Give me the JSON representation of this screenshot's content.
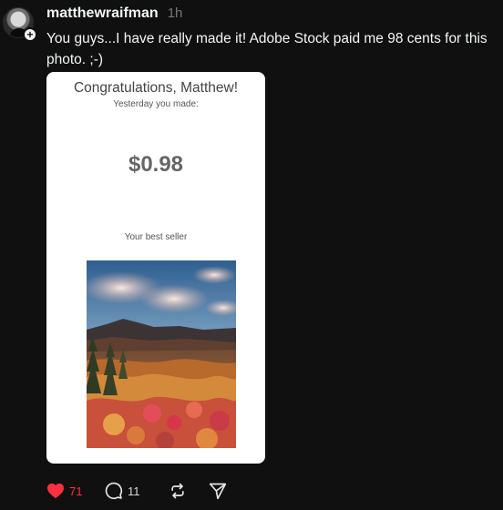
{
  "post": {
    "username": "matthewraifman",
    "time": "1h",
    "text": "You guys...I have really made it! Adobe Stock paid me 98 cents for this photo. ;-)",
    "avatar_icon": "user-avatar",
    "follow_icon": "plus-icon",
    "follow_label": "+"
  },
  "card": {
    "title": "Congratulations, Matthew!",
    "subtitle": "Yesterday you made:",
    "amount": "$0.98",
    "best_seller": "Your best seller",
    "photo_icon": "mountain-landscape-photo"
  },
  "actions": {
    "likes": "71",
    "replies": "11",
    "like_icon": "heart-icon",
    "reply_icon": "comment-icon",
    "repost_icon": "repost-icon",
    "share_icon": "send-icon"
  },
  "colors": {
    "background": "#101010",
    "text": "#f3f5f7",
    "muted": "#777777",
    "like": "#ff3040"
  }
}
